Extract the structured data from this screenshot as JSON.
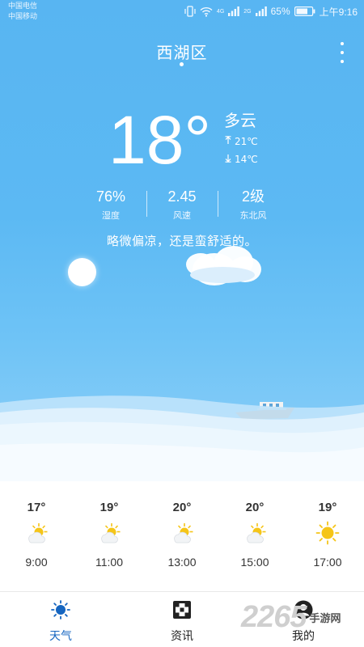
{
  "status_bar": {
    "carrier_1": "中国电信",
    "carrier_2": "中国移动",
    "net_1": "4G",
    "net_2": "2G",
    "battery": "65%",
    "time": "上午9:16"
  },
  "header": {
    "city": "西湖区"
  },
  "current": {
    "temp": "18°",
    "condition": "多云",
    "high": "21℃",
    "low": "14℃"
  },
  "stats": [
    {
      "value": "76%",
      "label": "湿度"
    },
    {
      "value": "2.45",
      "label": "风速"
    },
    {
      "value": "2级",
      "label": "东北风"
    }
  ],
  "tip": "略微偏凉，还是蛮舒适的。",
  "hourly": [
    {
      "temp": "17°",
      "time": "9:00",
      "icon": "partly-cloudy-sun-icon"
    },
    {
      "temp": "19°",
      "time": "11:00",
      "icon": "partly-cloudy-sun-icon"
    },
    {
      "temp": "20°",
      "time": "13:00",
      "icon": "partly-cloudy-sun-icon"
    },
    {
      "temp": "20°",
      "time": "15:00",
      "icon": "partly-cloudy-sun-icon"
    },
    {
      "temp": "19°",
      "time": "17:00",
      "icon": "sun-icon"
    }
  ],
  "nav": [
    {
      "label": "天气",
      "icon": "sun-icon",
      "active": true
    },
    {
      "label": "资讯",
      "icon": "news-icon",
      "active": false
    },
    {
      "label": "我的",
      "icon": "user-icon",
      "active": false
    }
  ],
  "watermark": {
    "number": "2265",
    "text": "手游网"
  },
  "colors": {
    "sky": "#5cb9f3",
    "active_nav": "#1565c0",
    "sun_icon": "#f5c518"
  }
}
